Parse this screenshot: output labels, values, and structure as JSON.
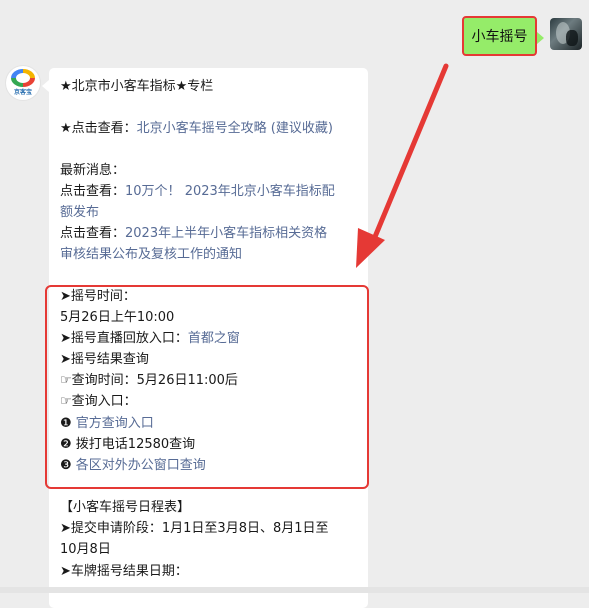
{
  "outgoing": {
    "text": "小车摇号"
  },
  "bot": {
    "avatar_caption": "京客宝"
  },
  "message": {
    "title": "★北京市小客车指标★专栏",
    "guide_prefix": "★点击查看：",
    "guide_link": "北京小客车摇号全攻略 (建议收藏)",
    "latest_heading": "最新消息：",
    "news1_prefix": "点击查看：",
    "news1_link_line1": "10万个！ 2023年北京小客车指标配",
    "news1_link_line2": "额发布",
    "news2_prefix": "点击查看：",
    "news2_link_line1": "2023年上半年小客车指标相关资格",
    "news2_link_line2": "审核结果公布及复核工作的通知",
    "lottery_time_label": "➤摇号时间：",
    "lottery_time_value": "5月26日上午10:00",
    "live_prefix": "➤摇号直播回放入口：",
    "live_link": "首都之窗",
    "result_heading": "➤摇号结果查询",
    "query_time": "☞查询时间：5月26日11:00后",
    "query_entry": "☞查询入口：",
    "entry1_num": "❶",
    "entry1_link": "官方查询入口",
    "entry2_num": "❷",
    "entry2_text": "拨打电话12580查询",
    "entry3_num": "❸",
    "entry3_link": "各区对外办公窗口查询",
    "schedule_title": "【小客车摇号日程表】",
    "submit_line1": "➤提交申请阶段：1月1日至3月8日、8月1日至",
    "submit_line2": "10月8日",
    "plate_result": "➤车牌摇号结果日期："
  }
}
